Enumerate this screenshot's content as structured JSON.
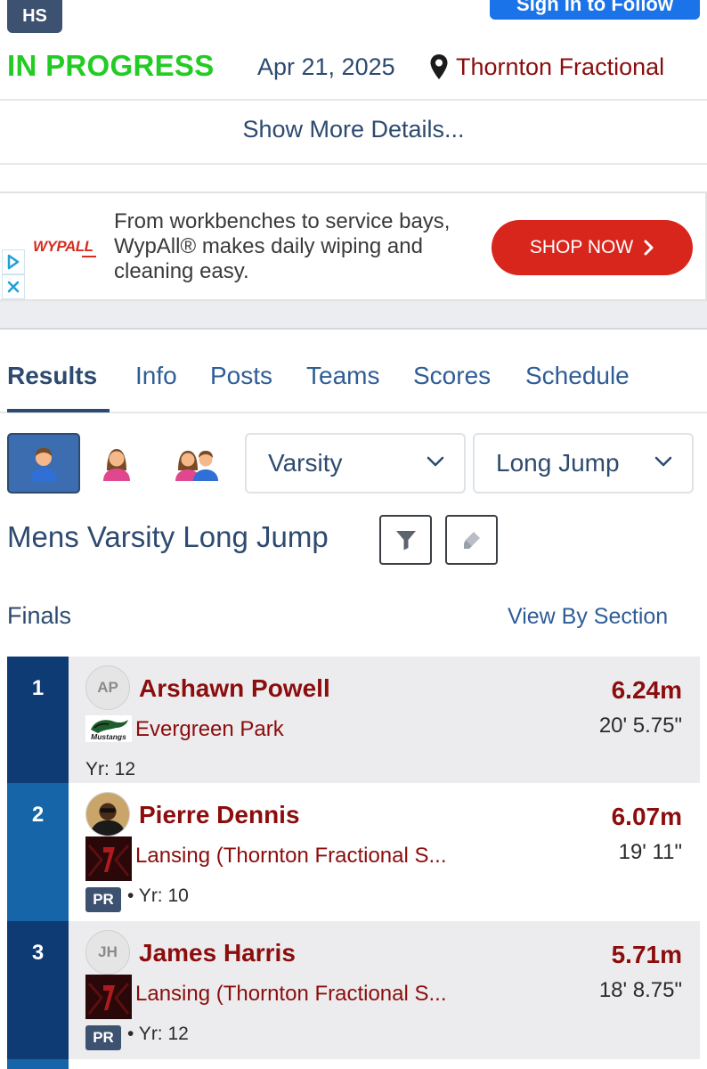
{
  "header": {
    "level_badge": "HS",
    "signin_label": "Sign In to Follow",
    "status": "IN PROGRESS",
    "date": "Apr 21, 2025",
    "location": "Thornton Fractional",
    "show_more": "Show More Details..."
  },
  "ad": {
    "logo": "WYPALL",
    "text": "From workbenches to service bays, WypAll® makes daily wiping and cleaning easy.",
    "button": "SHOP NOW"
  },
  "tabs": [
    "Results",
    "Info",
    "Posts",
    "Teams",
    "Scores",
    "Schedule"
  ],
  "active_tab": "Results",
  "filters": {
    "gender_options": [
      "mens-icon",
      "womens-icon",
      "mixed-icon"
    ],
    "selected_gender": "mens-icon",
    "division": "Varsity",
    "event": "Long Jump"
  },
  "event_title": "Mens Varsity Long Jump",
  "round": "Finals",
  "view_by_section": "View By Section",
  "results": [
    {
      "place": "1",
      "initials": "AP",
      "name": "Arshawn Powell",
      "school": "Evergreen Park",
      "school_logo_text": "Mustangs",
      "pr": "",
      "year": "Yr: 12",
      "mark_metric": "6.24m",
      "mark_imperial": "20' 5.75\""
    },
    {
      "place": "2",
      "initials": "",
      "name": "Pierre Dennis",
      "school": "Lansing (Thornton Fractional S...",
      "school_logo_text": "",
      "pr": "PR",
      "year": "• Yr: 10",
      "mark_metric": "6.07m",
      "mark_imperial": "19' 11\""
    },
    {
      "place": "3",
      "initials": "JH",
      "name": "James Harris",
      "school": "Lansing (Thornton Fractional S...",
      "school_logo_text": "",
      "pr": "PR",
      "year": "• Yr: 12",
      "mark_metric": "5.71m",
      "mark_imperial": "18' 8.75\""
    }
  ],
  "colors": {
    "status": "#22cc22",
    "brand_navy": "#2d4a6f",
    "athlete_red": "#8b0d0d",
    "place_dark": "#0e3b73",
    "place_mid": "#1565a8",
    "ad_red": "#d8261d"
  }
}
